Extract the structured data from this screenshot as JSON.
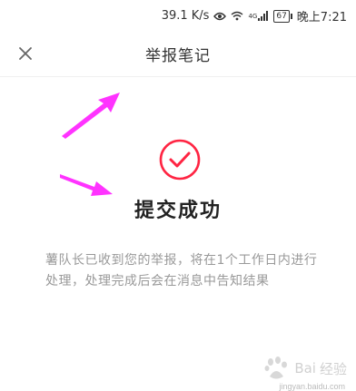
{
  "status_bar": {
    "speed": "39.1 K/s",
    "network": "4G",
    "battery": "67",
    "time": "晚上7:21",
    "icons": [
      "eye-icon",
      "wifi-icon",
      "signal-icon",
      "battery-icon"
    ]
  },
  "nav": {
    "title": "举报笔记",
    "close_icon": "close-icon"
  },
  "result": {
    "icon": "check-circle-icon",
    "title": "提交成功",
    "description": "薯队长已收到您的举报，将在1个工作日内进行处理，处理完成后会在消息中告知结果"
  },
  "watermark": {
    "logo_text": "Bai",
    "brand": "经验",
    "url": "jingyan.baidu.com"
  },
  "colors": {
    "accent": "#ff2442",
    "annotation_arrow": "#ff33ff",
    "text_primary": "#222222",
    "text_secondary": "#999999"
  }
}
